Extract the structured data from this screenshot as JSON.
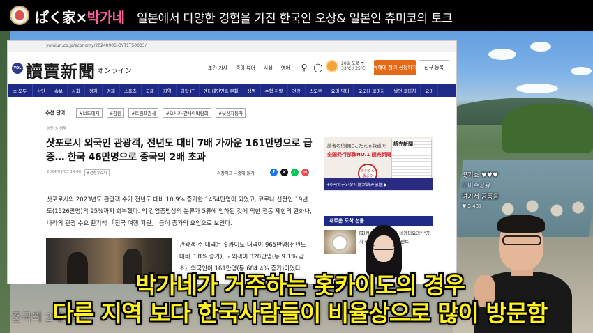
{
  "channel": {
    "name_part1": "ぱく家",
    "name_x": "×",
    "name_part2": "박가네",
    "subtitle": "일본에서 다양한 경험을 가진 한국인 오상& 일본인 츄미코의 토크"
  },
  "browser": {
    "url": "yomiuri.co.jp/economy/20240905-OYT1T50003/"
  },
  "site": {
    "logo_badge": "YOL",
    "masthead": "讀賣新聞",
    "masthead_sub": "オンライン",
    "top_nav": [
      "조간 기사",
      "종이 뷰어",
      "사설",
      "영어"
    ],
    "weather_line1": "20일 도쿄 ☂",
    "weather_line2": "33℃ / 25℃",
    "subscribe_button": "독해에 참여 신청하기",
    "register_button": "신규 등록",
    "menu_label": "≡ 모두",
    "categories": [
      "상단",
      "속보",
      "사회",
      "정치",
      "경제",
      "스포츠",
      "국제",
      "지역",
      "과학·IT",
      "엔터테인먼트·문화",
      "생명",
      "수험·취활",
      "건강",
      "스도쿠",
      "요미 닥터",
      "오모테 코마치",
      "발언 코마치",
      "요미"
    ]
  },
  "trending": {
    "label": "추천 단어",
    "tags": [
      "#보드예지",
      "#참원",
      "#트럼프관세",
      "#오사카·간사이박람회",
      "#닛산자동차"
    ]
  },
  "article": {
    "breadcrumb": "상단 > 경제",
    "headline": "삿포로시 외국인 관광객, 전년도 대비 7배 가까운 161만명으로 급증… 한국 46만명으로 중국의 2배 초과",
    "date": "2024/09/05 14:40",
    "tag": "#선정우로나",
    "save_label": "저장하고 나중에 읽기",
    "para1": "삿포로시의 2023년도 관광객 수가 전년도 대비 10.9% 증가한 1454만명이 되었고, 코로나 선전인 19년도(1526만명)의 95%까지 회복했다. 의 감염증법상의 분류가 5류에 인하된 것에 의한 행동 제한의 완화나, 나라의 관광 수요 환기책 「전국 여행 지원」 등이 증가의 요인으로 보인다.",
    "para2": "관광객 수 내역은 홋카이도 내역이 965만명(전년도 대비 3.8% 증가), 도외객이 328만명(동 9.1% 감소), 외국인이 161만명(동 684.4% 증가)이었다."
  },
  "ad": {
    "line1": "読者の信頼にこたえる報道で",
    "line2": "全国発行部数NO.1 読売新聞",
    "badge": "デジタル版より",
    "paper_head": "読売新聞",
    "bar": "+0円でデジタル版が読み放題 ▶"
  },
  "sidebar": {
    "new_arrivals": "새로운 도착 선물",
    "gift_text": "[회원 한정 ] 사 사카 네카미요리\" \"공 차 6(kg)을 독자 프레젠트"
  },
  "chat": {
    "line1": "꿋기쇼 ♥♥♥",
    "line2": "도미수공유",
    "line3": "여기서 궁동을",
    "line4": "♥ 3,487"
  },
  "subtitles": {
    "line1": "박가네가 거주하는 홋카이도의 경우",
    "line2": "다른 지역 보다 한국사람들이 비율상으로 많이 방문함",
    "ghost": "중국의 2배 고스"
  }
}
